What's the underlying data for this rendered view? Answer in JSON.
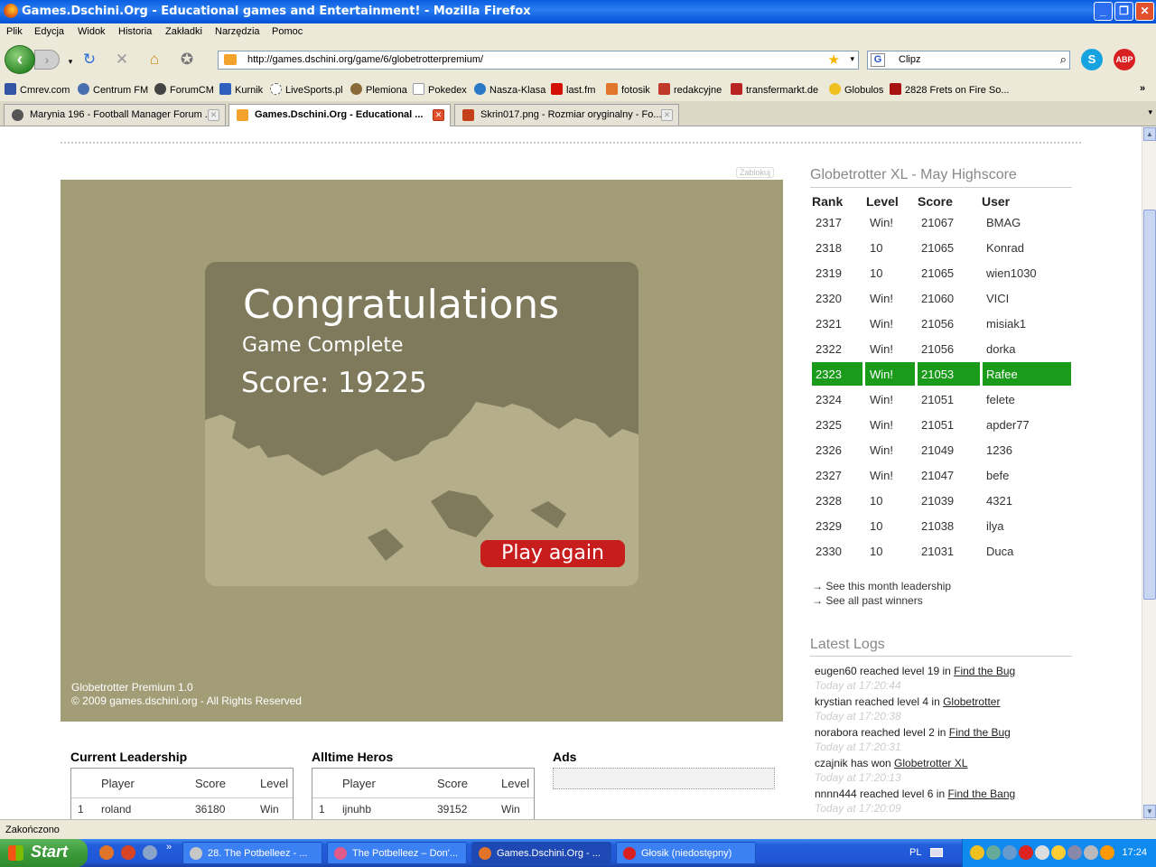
{
  "window": {
    "title": "Games.Dschini.Org - Educational games and Entertainment! - Mozilla Firefox"
  },
  "menu": [
    "Plik",
    "Edycja",
    "Widok",
    "Historia",
    "Zakładki",
    "Narzędzia",
    "Pomoc"
  ],
  "address": {
    "url": "http://games.dschini.org/game/6/globetrotterpremium/"
  },
  "search": {
    "value": "Clipz"
  },
  "toolbar": {
    "abp_label": "ABP",
    "skype_label": "S"
  },
  "bookmarks": [
    "Cmrev.com",
    "Centrum FM",
    "ForumCM",
    "Kurnik",
    "LiveSports.pl",
    "Plemiona",
    "Pokedex",
    "Nasza-Klasa",
    "last.fm",
    "fotosik",
    "redakcyjne",
    "transfermarkt.de",
    "Globulos",
    "2828 Frets on Fire So..."
  ],
  "tabs": [
    {
      "label": "Marynia 196 - Football Manager Forum ..."
    },
    {
      "label": "Games.Dschini.Org - Educational ..."
    },
    {
      "label": "Skrin017.png - Rozmiar oryginalny - Fo..."
    }
  ],
  "game": {
    "block_label": "Zablokuj",
    "congrats": "Congratulations",
    "subtitle": "Game Complete",
    "score": "Score: 19225",
    "play_again": "Play again",
    "footer_line1": "Globetrotter Premium 1.0",
    "footer_line2": "© 2009 games.dschini.org - All Rights Reserved"
  },
  "current_leadership": {
    "title": "Current Leadership",
    "headers": [
      "Player",
      "Score",
      "Level"
    ],
    "rows": [
      {
        "rank": "1",
        "player": "roland",
        "score": "36180",
        "level": "Win"
      }
    ]
  },
  "alltime_heros": {
    "title": "Alltime Heros",
    "headers": [
      "Player",
      "Score",
      "Level"
    ],
    "rows": [
      {
        "rank": "1",
        "player": "ijnuhb",
        "score": "39152",
        "level": "Win"
      }
    ]
  },
  "ads": {
    "title": "Ads"
  },
  "highscore": {
    "title": "Globetrotter XL - May Highscore",
    "headers": [
      "Rank",
      "Level",
      "Score",
      "User"
    ],
    "rows": [
      {
        "rank": "2317",
        "level": "Win!",
        "score": "21067",
        "user": "BMAG"
      },
      {
        "rank": "2318",
        "level": "10",
        "score": "21065",
        "user": "Konrad"
      },
      {
        "rank": "2319",
        "level": "10",
        "score": "21065",
        "user": "wien1030"
      },
      {
        "rank": "2320",
        "level": "Win!",
        "score": "21060",
        "user": "VICI"
      },
      {
        "rank": "2321",
        "level": "Win!",
        "score": "21056",
        "user": "misiak1"
      },
      {
        "rank": "2322",
        "level": "Win!",
        "score": "21056",
        "user": "dorka"
      },
      {
        "rank": "2323",
        "level": "Win!",
        "score": "21053",
        "user": "Rafee",
        "highlight": true
      },
      {
        "rank": "2324",
        "level": "Win!",
        "score": "21051",
        "user": "felete"
      },
      {
        "rank": "2325",
        "level": "Win!",
        "score": "21051",
        "user": "apder77"
      },
      {
        "rank": "2326",
        "level": "Win!",
        "score": "21049",
        "user": "1236"
      },
      {
        "rank": "2327",
        "level": "Win!",
        "score": "21047",
        "user": "befe"
      },
      {
        "rank": "2328",
        "level": "10",
        "score": "21039",
        "user": "4321"
      },
      {
        "rank": "2329",
        "level": "10",
        "score": "21038",
        "user": "ilya"
      },
      {
        "rank": "2330",
        "level": "10",
        "score": "21031",
        "user": "Duca"
      }
    ],
    "links": [
      "→ See this month leadership",
      "→ See all past winners"
    ],
    "highlight_color": "#1a9b1a"
  },
  "latest_logs": {
    "title": "Latest Logs",
    "items": [
      {
        "text": "eugen60 reached level 19 in ",
        "game": "Find the Bug",
        "time": "Today at 17:20:44"
      },
      {
        "text": "krystian reached level 4 in ",
        "game": "Globetrotter",
        "time": "Today at 17:20:38"
      },
      {
        "text": "norabora reached level 2 in ",
        "game": "Find the Bug",
        "time": "Today at 17:20:31"
      },
      {
        "text": "czajnik has won ",
        "game": "Globetrotter XL",
        "time": "Today at 17:20:13"
      },
      {
        "text": "nnnn444 reached level 6 in ",
        "game": "Find the Bang",
        "time": "Today at 17:20:09"
      }
    ]
  },
  "status": {
    "text": "Zakończono"
  },
  "taskbar": {
    "start": "Start",
    "tasks": [
      {
        "label": "28. The Potbelleez - ..."
      },
      {
        "label": "The Potbelleez – Don'..."
      },
      {
        "label": "Games.Dschini.Org - ..."
      },
      {
        "label": "Głosik (niedostępny)"
      }
    ],
    "lang": "PL",
    "time": "17:24"
  }
}
